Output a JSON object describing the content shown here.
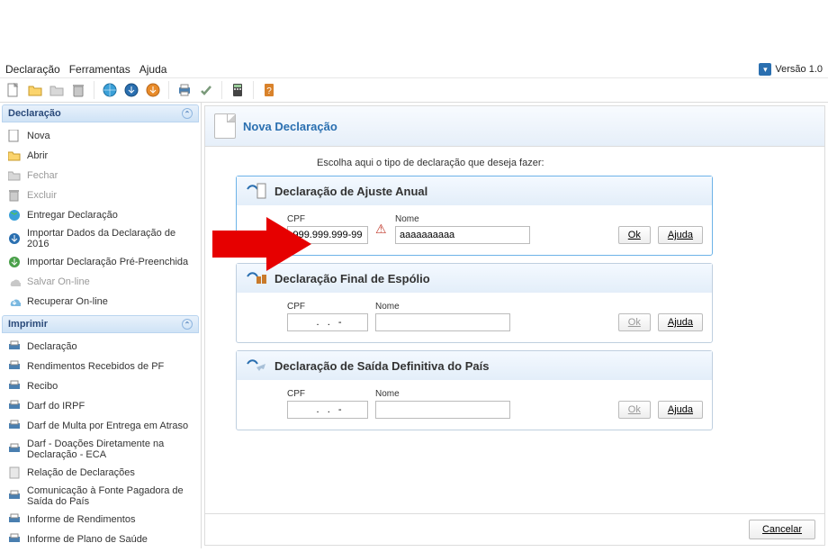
{
  "menubar": {
    "items": [
      "Declaração",
      "Ferramentas",
      "Ajuda"
    ],
    "version_label": "Versão 1.0"
  },
  "sidebar": {
    "declaracao": {
      "title": "Declaração",
      "items": [
        {
          "label": "Nova",
          "icon": "page"
        },
        {
          "label": "Abrir",
          "icon": "folder"
        },
        {
          "label": "Fechar",
          "icon": "folder-gray",
          "disabled": true
        },
        {
          "label": "Excluir",
          "icon": "trash",
          "disabled": true
        },
        {
          "label": "Entregar Declaração",
          "icon": "globe"
        },
        {
          "label": "Importar Dados da Declaração de 2016",
          "icon": "import-blue"
        },
        {
          "label": "Importar Declaração Pré-Preenchida",
          "icon": "import-green"
        },
        {
          "label": "Salvar On-line",
          "icon": "cloud",
          "disabled": true
        },
        {
          "label": "Recuperar On-line",
          "icon": "cloud-down"
        }
      ]
    },
    "imprimir": {
      "title": "Imprimir",
      "items": [
        {
          "label": "Declaração",
          "icon": "printer"
        },
        {
          "label": "Rendimentos Recebidos de PF",
          "icon": "printer"
        },
        {
          "label": "Recibo",
          "icon": "printer"
        },
        {
          "label": "Darf do IRPF",
          "icon": "printer"
        },
        {
          "label": "Darf de Multa por Entrega em Atraso",
          "icon": "printer"
        },
        {
          "label": "Darf - Doações Diretamente na Declaração - ECA",
          "icon": "printer"
        },
        {
          "label": "Relação de Declarações",
          "icon": "doc"
        },
        {
          "label": "Comunicação à Fonte Pagadora de Saída do País",
          "icon": "printer"
        },
        {
          "label": "Informe de Rendimentos",
          "icon": "printer"
        },
        {
          "label": "Informe de Plano de Saúde",
          "icon": "printer"
        }
      ]
    }
  },
  "content": {
    "title": "Nova Declaração",
    "instruction": "Escolha aqui o tipo de declaração que deseja fazer:",
    "cards": [
      {
        "title": "Declaração de Ajuste Anual",
        "cpf_label": "CPF",
        "nome_label": "Nome",
        "cpf_value": "999.999.999-99",
        "nome_value": "aaaaaaaaaa",
        "ok_label": "Ok",
        "ajuda_label": "Ajuda",
        "warn": true,
        "active": true,
        "ok_enabled": true
      },
      {
        "title": "Declaração Final de Espólio",
        "cpf_label": "CPF",
        "nome_label": "Nome",
        "cpf_value": "   .   .   -  ",
        "nome_value": "",
        "ok_label": "Ok",
        "ajuda_label": "Ajuda",
        "warn": false,
        "active": false,
        "ok_enabled": false
      },
      {
        "title": "Declaração de Saída Definitiva do País",
        "cpf_label": "CPF",
        "nome_label": "Nome",
        "cpf_value": "   .   .   -  ",
        "nome_value": "",
        "ok_label": "Ok",
        "ajuda_label": "Ajuda",
        "warn": false,
        "active": false,
        "ok_enabled": false
      }
    ],
    "cancel_label": "Cancelar"
  }
}
